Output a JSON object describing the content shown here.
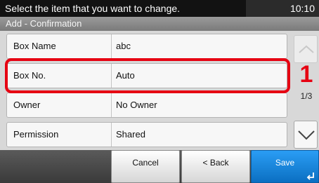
{
  "status_bar": {
    "message": "Select the item that you want to change.",
    "time": "10:10"
  },
  "title": "Add - Confirmation",
  "rows": [
    {
      "label": "Box Name",
      "value": "abc"
    },
    {
      "label": "Box No.",
      "value": "Auto"
    },
    {
      "label": "Owner",
      "value": "No Owner"
    },
    {
      "label": "Permission",
      "value": "Shared"
    }
  ],
  "callout_number": "1",
  "page_indicator": "1/3",
  "buttons": {
    "cancel": "Cancel",
    "back": "< Back",
    "save": "Save"
  },
  "icons": {
    "scroll_up": "chevron-up-icon",
    "scroll_down": "chevron-down-icon",
    "save_enter": "enter-return-icon"
  },
  "colors": {
    "highlight": "#e60012",
    "save_button": "#1a86dc"
  }
}
